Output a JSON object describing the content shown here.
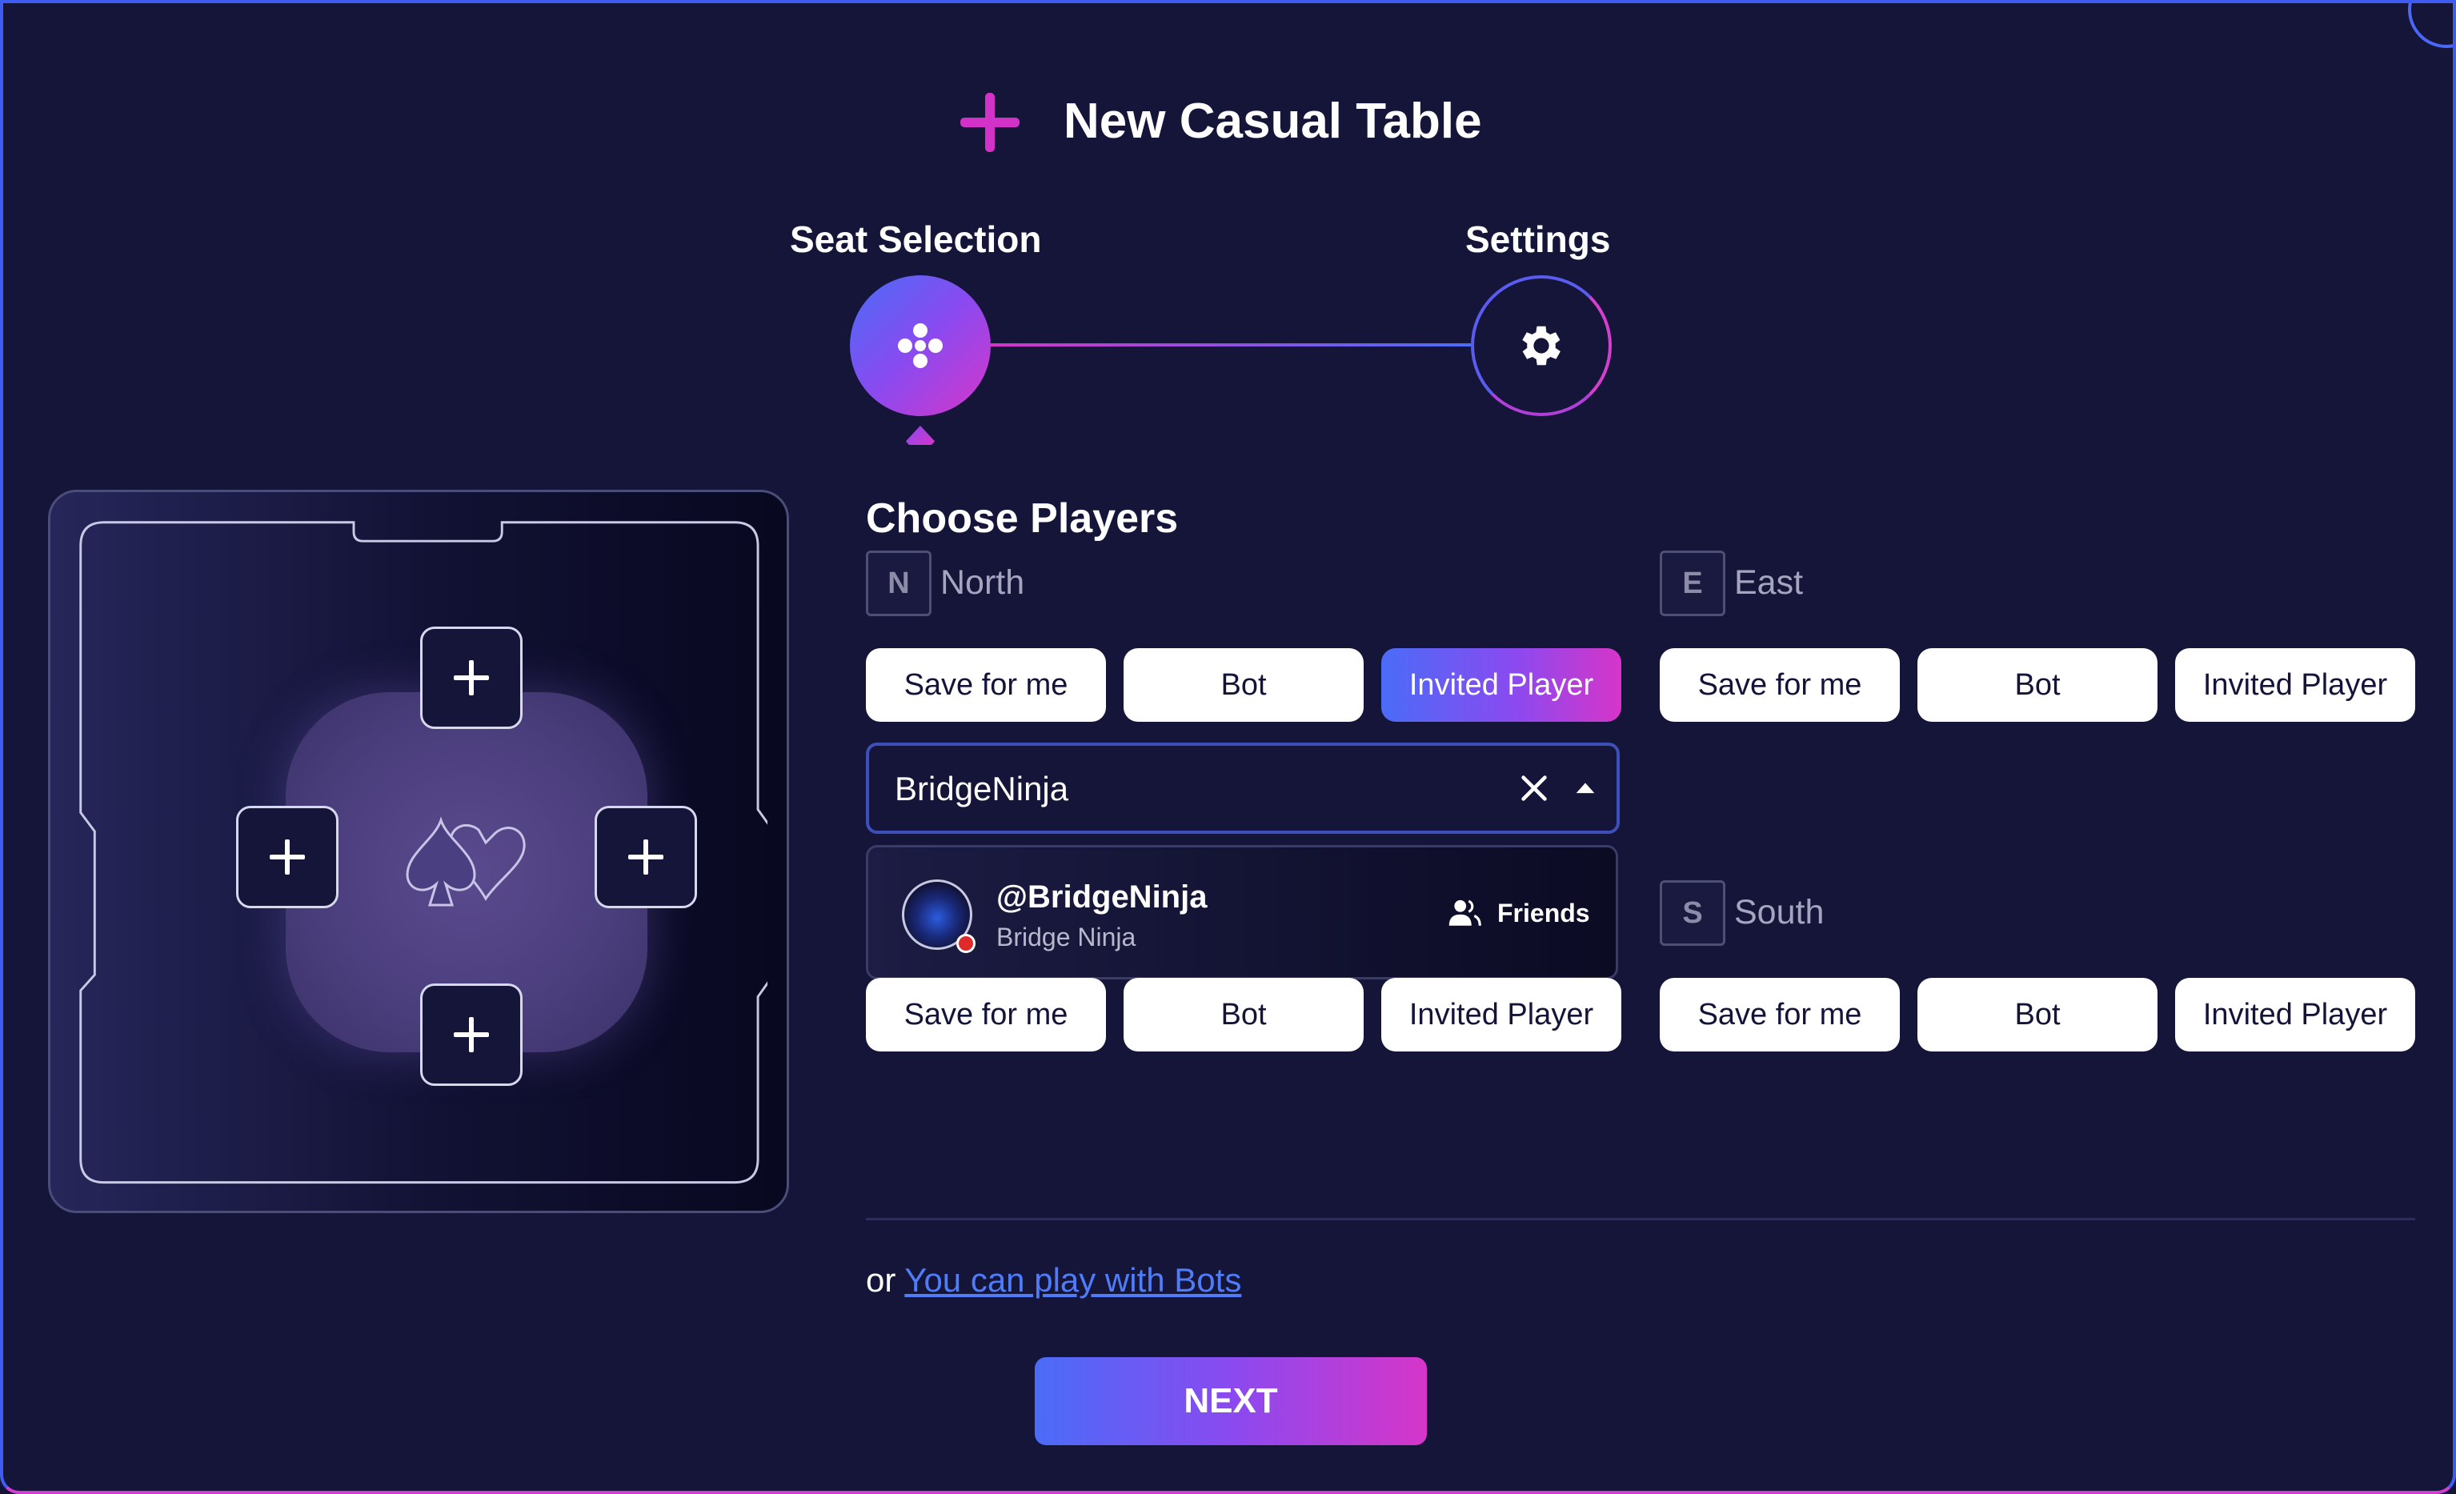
{
  "header": {
    "title": "New Casual Table"
  },
  "steps": [
    {
      "label": "Seat Selection",
      "icon": "grid-dots-icon",
      "active": true
    },
    {
      "label": "Settings",
      "icon": "gear-icon",
      "active": false
    }
  ],
  "main": {
    "section_title": "Choose Players",
    "seats": {
      "north": {
        "badge": "N",
        "name": "North",
        "options": [
          "Save for me",
          "Bot",
          "Invited Player"
        ],
        "selected": "Invited Player"
      },
      "east": {
        "badge": "E",
        "name": "East",
        "options": [
          "Save for me",
          "Bot",
          "Invited Player"
        ],
        "selected": ""
      },
      "south": {
        "badge": "S",
        "name": "South",
        "options": [
          "Save for me",
          "Bot",
          "Invited Player"
        ],
        "selected": ""
      },
      "west": {
        "options": [
          "Save for me",
          "Bot",
          "Invited Player"
        ],
        "selected": ""
      }
    },
    "search": {
      "value": "BridgeNinja"
    },
    "dropdown_result": {
      "handle": "@BridgeNinja",
      "name": "Bridge Ninja",
      "tag": "Friends",
      "status": "offline"
    },
    "bots_prefix": "or",
    "bots_link": "You can play with Bots",
    "next_label": "NEXT"
  },
  "colors": {
    "accent_blue": "#4a6cf7",
    "accent_magenta": "#d635c8",
    "background": "#15153a",
    "link": "#4f7cf9"
  }
}
